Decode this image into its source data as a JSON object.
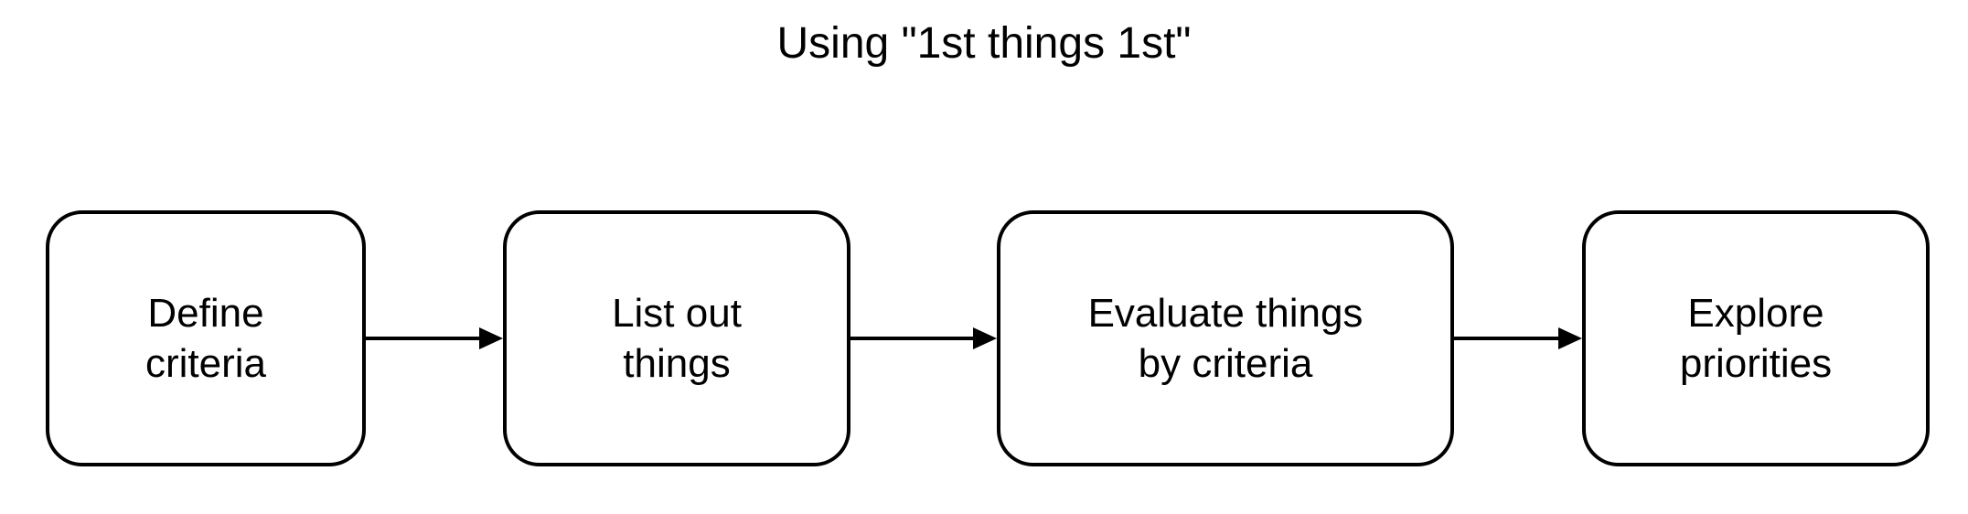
{
  "title": "Using \"1st things 1st\"",
  "steps": [
    {
      "label": "Define\ncriteria"
    },
    {
      "label": "List out\nthings"
    },
    {
      "label": "Evaluate things\nby criteria"
    },
    {
      "label": "Explore\npriorities"
    }
  ]
}
